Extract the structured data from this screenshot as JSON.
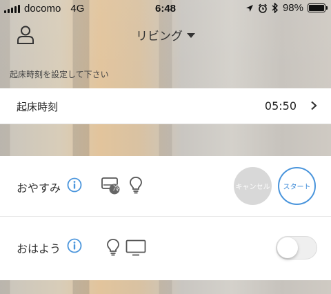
{
  "status_bar": {
    "carrier": "docomo",
    "network": "4G",
    "time": "6:48",
    "battery": "98%",
    "battery_level": 0.98,
    "icons": [
      "location-icon",
      "alarm-icon",
      "bluetooth-icon"
    ]
  },
  "header": {
    "room": "リビング",
    "icons": [
      "user-icon",
      "dropdown-caret-icon"
    ]
  },
  "hint": "起床時刻を設定して下さい",
  "wake_time": {
    "label": "起床時刻",
    "value": "05:50"
  },
  "scenes": {
    "night": {
      "label": "おやすみ",
      "device_icons": [
        "aircon-cool-icon",
        "bulb-icon"
      ],
      "badge": "冷",
      "cancel_label": "キャンセル",
      "start_label": "スタート"
    },
    "morning": {
      "label": "おはよう",
      "device_icons": [
        "bulb-icon",
        "tv-icon"
      ],
      "enabled": false
    }
  },
  "colors": {
    "accent": "#4a95dc",
    "cancel_bg": "#d8d8d8",
    "panel_bg": "#ffffff"
  }
}
